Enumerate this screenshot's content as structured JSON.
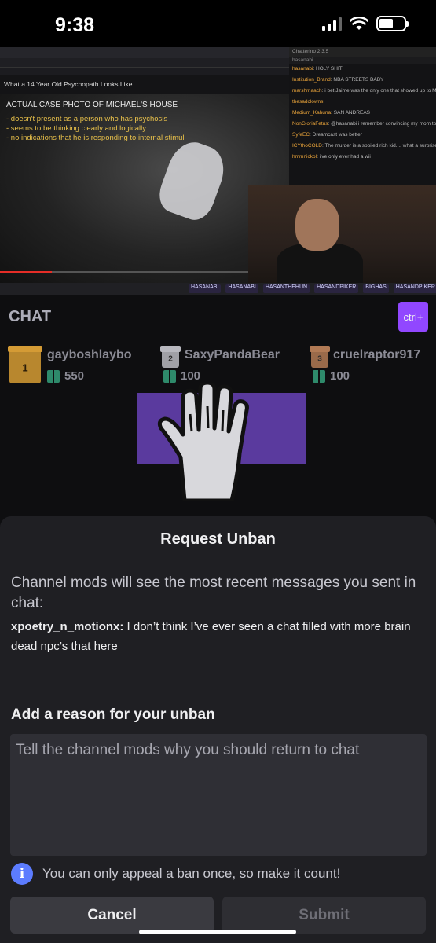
{
  "status_bar": {
    "time": "9:38"
  },
  "video": {
    "browser_title": "What a 14 Year Old Psychopath Looks Like",
    "caption_heading": "ACTUAL CASE PHOTO OF MICHAEL'S HOUSE",
    "caption_lines": [
      "- doesn't present as a person who has psychosis",
      "- seems to be thinking clearly and logically",
      "- no indications that he is responding to internal stimuli"
    ],
    "chatterino_title": "Chatterino 2.3.5",
    "chatterino_channel": "hasanabi",
    "chat_messages": [
      {
        "user": "hasanabi",
        "text": "HOLY SHIT"
      },
      {
        "user": "Institution_Brand",
        "text": "NBA STREETS BABY"
      },
      {
        "user": "marshmaach",
        "text": "i bet Jaime was the only one that showed up to Michael's birthday party"
      },
      {
        "user": "thesadclowns",
        "text": ""
      },
      {
        "user": "Medium_Kahuna",
        "text": "SAN ANDREAS"
      },
      {
        "user": "NonGloriaFetus",
        "text": "@hasanabi i remember convincing my mom to buy one because it could also play dvds"
      },
      {
        "user": "SyfeEC",
        "text": "Dreamcast was better"
      },
      {
        "user": "ICYthoCOLD",
        "text": "The murder is a spoiled rich kid.... what a surprise lol"
      },
      {
        "user": "hmmnickol",
        "text": "i've only ever had a wii"
      }
    ],
    "social_tags": [
      "HASANABI",
      "HASANABI",
      "HASANTHEHUN",
      "HASANDPIKER",
      "BIGHAS",
      "HASANDPIKER"
    ],
    "progress_fraction": 0.18
  },
  "chat": {
    "title": "CHAT",
    "ctrl_label": "ctrl+",
    "gifters": [
      {
        "rank": "1",
        "name": "gayboshlaybo",
        "count": "550"
      },
      {
        "rank": "2",
        "name": "SaxyPandaBear",
        "count": "100"
      },
      {
        "rank": "3",
        "name": "cruelraptor917",
        "count": "100"
      }
    ]
  },
  "sheet": {
    "title": "Request Unban",
    "description": "Channel mods will see the most recent messages you sent in chat:",
    "message_user": "xpoetry_n_motionx:",
    "message_text": " I don’t think I’ve ever seen a chat filled with more brain dead npc’s that here",
    "reason_label": "Add a reason for your unban",
    "reason_placeholder": "Tell the channel mods why you should return to chat",
    "notice": "You can only appeal a ban once, so make it count!",
    "cancel_label": "Cancel",
    "submit_label": "Submit"
  },
  "colors": {
    "accent": "#9147ff",
    "info": "#5c7cff",
    "sheet_bg": "#1f1f23",
    "input_bg": "#2f2f35"
  }
}
